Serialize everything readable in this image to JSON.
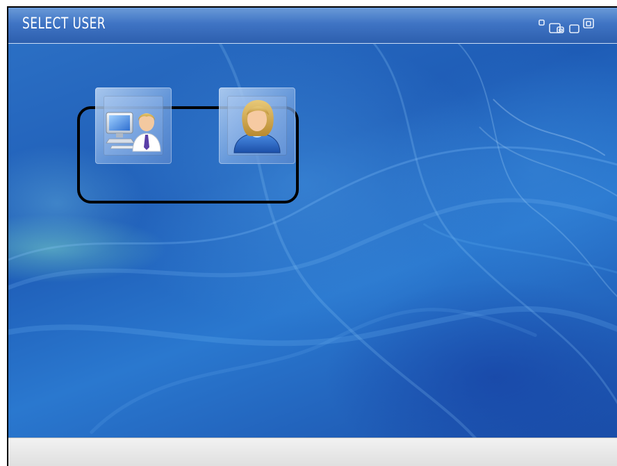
{
  "window": {
    "title": "SELECT USER"
  },
  "users": [
    {
      "icon": "administrator-computer-user-icon"
    },
    {
      "icon": "standard-user-icon"
    }
  ],
  "colors": {
    "titlebar": "#3f74c4",
    "background": "#1e5cb6",
    "footer": "#e6e6e6",
    "highlight_border": "#000000"
  }
}
